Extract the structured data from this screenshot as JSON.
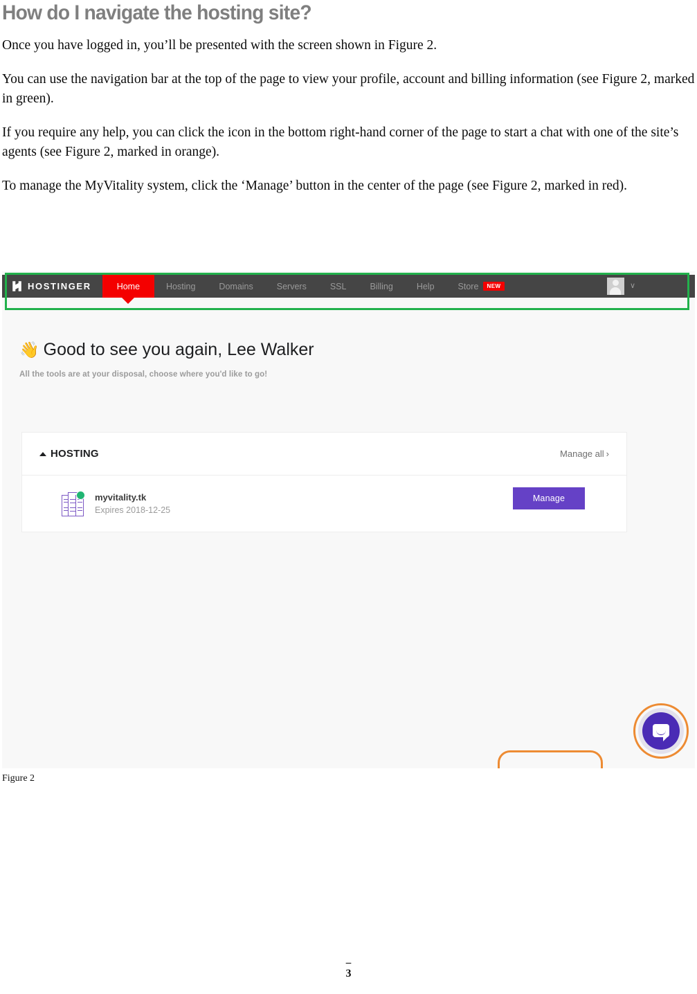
{
  "document": {
    "title": "How do I navigate the hosting site?",
    "paragraphs": [
      "Once you have logged in, you’ll be presented with the screen shown in Figure 2.",
      "You can use the navigation bar at the top of the page to view your profile, account and billing information (see Figure 2, marked in green).",
      "If you require any help, you can click the icon in the bottom right-hand corner of the page to start a chat with one of the site’s agents (see Figure 2, marked in orange).",
      "To manage the MyVitality system, click the ‘Manage’ button in the center of the page (see Figure 2, marked in red)."
    ],
    "figure_caption": "Figure 2",
    "footer": {
      "dash": "–",
      "page_number": "3"
    }
  },
  "screenshot": {
    "navbar": {
      "brand": "HOSTINGER",
      "brand_icon": "hostinger-h-logo-icon",
      "items": [
        {
          "label": "Home",
          "active": true
        },
        {
          "label": "Hosting",
          "active": false
        },
        {
          "label": "Domains",
          "active": false
        },
        {
          "label": "Servers",
          "active": false
        },
        {
          "label": "SSL",
          "active": false
        },
        {
          "label": "Billing",
          "active": false
        },
        {
          "label": "Help",
          "active": false
        },
        {
          "label": "Store",
          "active": false,
          "badge": "NEW"
        }
      ],
      "account": {
        "avatar_icon": "user-avatar-icon",
        "chevron_icon": "chevron-down-icon",
        "chevron_glyph": "∨"
      },
      "colors": {
        "bar_background": "#454545",
        "active_tab": "#f40000",
        "item_text": "#9a9a9a",
        "badge": "#f40000"
      }
    },
    "greeting": {
      "wave_icon": "waving-hand-icon",
      "wave_glyph": "👋",
      "heading": "Good to see you again, Lee Walker",
      "subtext": "All the tools are at your disposal, choose where you'd like to go!"
    },
    "hosting_card": {
      "collapse_icon": "triangle-up-icon",
      "title": "HOSTING",
      "manage_all_label": "Manage all",
      "manage_all_arrow": "›",
      "rows": [
        {
          "icon": "server-stack-icon",
          "status_icon": "status-active-dot-icon",
          "status_color": "#21b573",
          "domain": "myvitality.tk",
          "expires": "Expires 2018-12-25",
          "action_label": "Manage",
          "action_color": "#6541c6"
        }
      ]
    },
    "chat": {
      "icon": "chat-bubble-icon",
      "color": "#4a2bb5"
    },
    "annotations": [
      {
        "name": "green-navbar-highlight",
        "color": "#22b14c",
        "shape": "rectangle",
        "target": "navbar"
      },
      {
        "name": "orange-manage-highlight",
        "color": "#ed8b33",
        "shape": "rounded-rectangle",
        "target": "manage-button"
      },
      {
        "name": "orange-chat-highlight",
        "color": "#ed8b33",
        "shape": "circle",
        "target": "chat-button"
      }
    ]
  }
}
